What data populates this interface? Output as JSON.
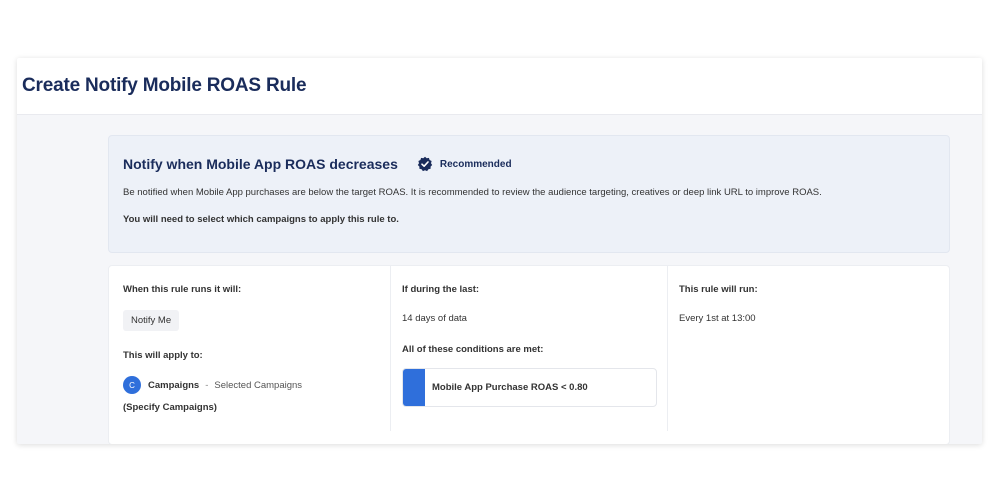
{
  "page": {
    "title": "Create Notify Mobile ROAS Rule"
  },
  "info": {
    "title": "Notify when Mobile App ROAS decreases",
    "badge_label": "Recommended",
    "badge_icon": "verified-badge-icon",
    "description": "Be notified when Mobile App purchases are below the target ROAS. It is recommended to review the audience targeting, creatives or deep link URL to improve ROAS.",
    "note": "You will need to select which campaigns to apply this rule to."
  },
  "rule": {
    "action_label": "When this rule runs it will:",
    "action_value": "Notify Me",
    "apply_label": "This will apply to:",
    "campaign_avatar": "C",
    "campaign_name": "Campaigns",
    "campaign_separator": "-",
    "campaign_selection": "Selected Campaigns",
    "specify_text": "(Specify Campaigns)",
    "period_label": "If during the last:",
    "period_value": "14 days of data",
    "conditions_label": "All of these conditions are met:",
    "conditions": [
      "Mobile App Purchase ROAS < 0.80"
    ],
    "schedule_label": "This rule will run:",
    "schedule_value": "Every 1st at 13:00"
  },
  "colors": {
    "title": "#1a2c5b",
    "accent": "#2f6fdb",
    "info_bg": "#edf1f8"
  }
}
